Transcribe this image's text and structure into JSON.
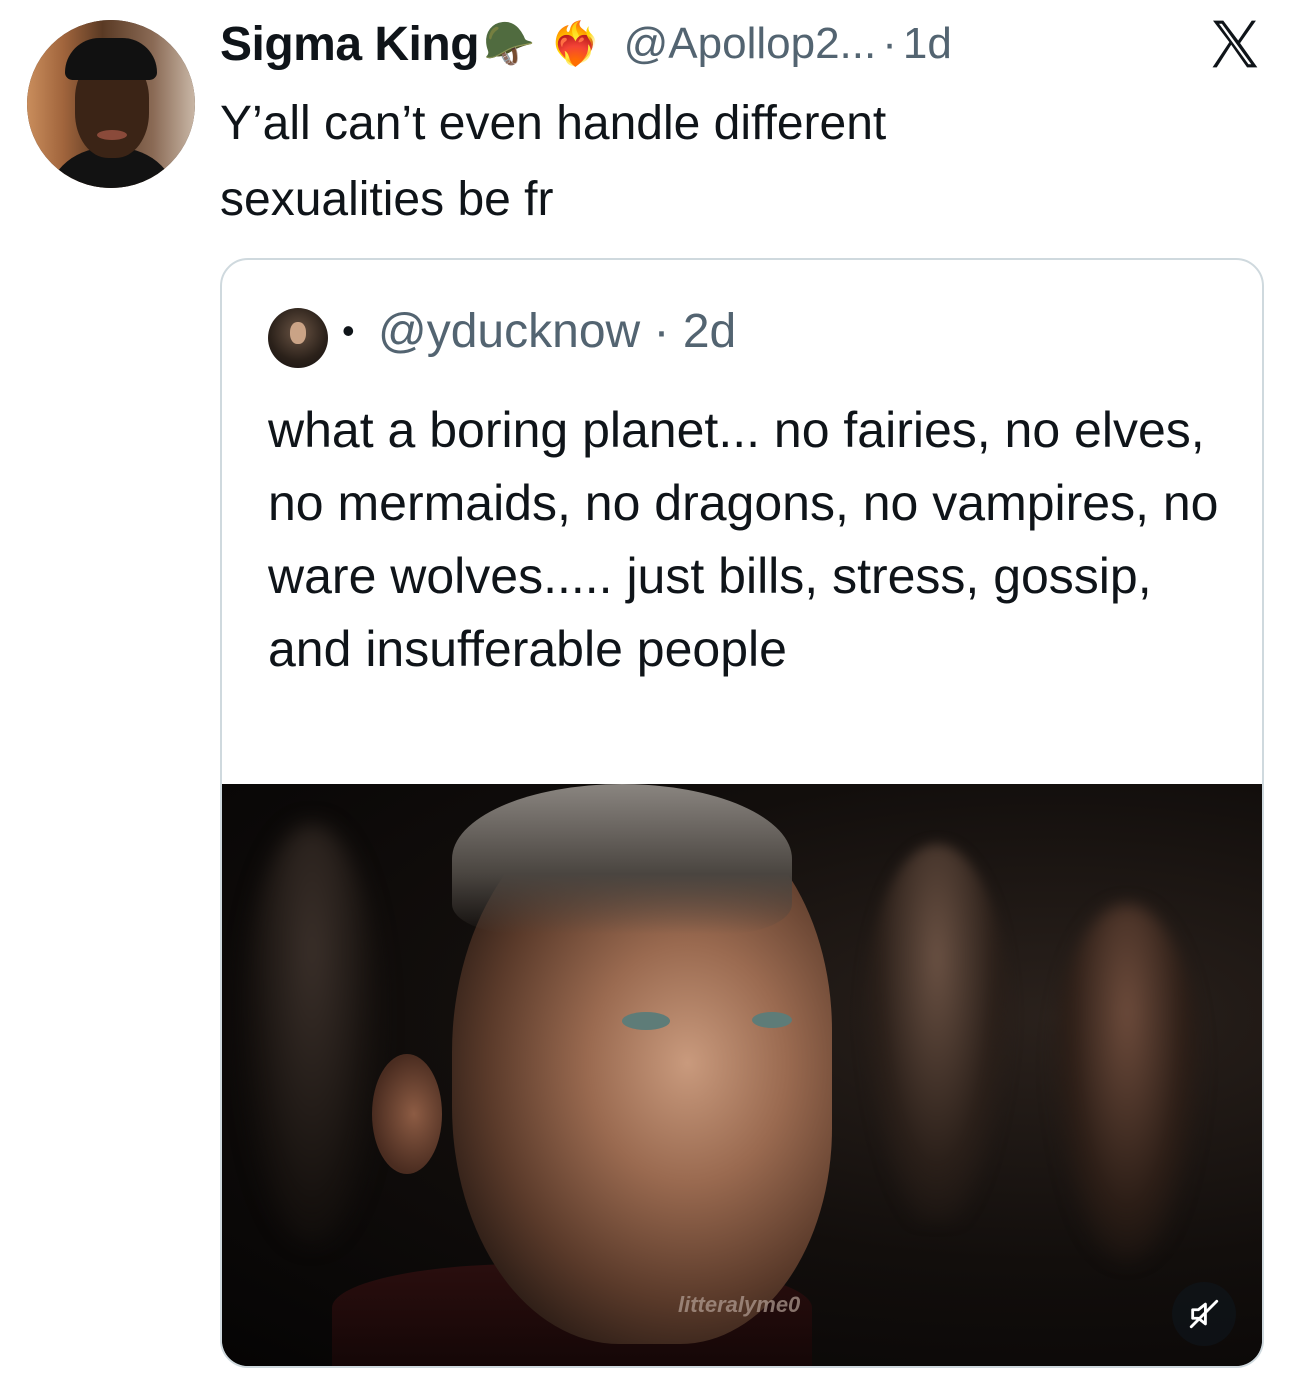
{
  "tweet": {
    "display_name": "Sigma King",
    "emojis": [
      "🪖",
      "❤️‍🔥"
    ],
    "handle": "@Apollop2...",
    "separator": "·",
    "time": "1d",
    "text": "Y’all can’t even handle different sexualities be fr"
  },
  "quoted_tweet": {
    "bullet": "•",
    "handle": "@yducknow",
    "separator": "·",
    "time": "2d",
    "text": "what a boring planet... no fairies, no elves, no mermaids, no dragons, no vampires, no ware wolves..... just bills, stress, gossip, and insufferable people",
    "media": {
      "watermark": "litteralyme0"
    }
  },
  "icons": {
    "x_logo": "x-logo-icon",
    "mute": "speaker-muted-icon"
  },
  "colors": {
    "text_primary": "#0f1419",
    "text_secondary": "#536471",
    "border": "#cfd9de"
  }
}
